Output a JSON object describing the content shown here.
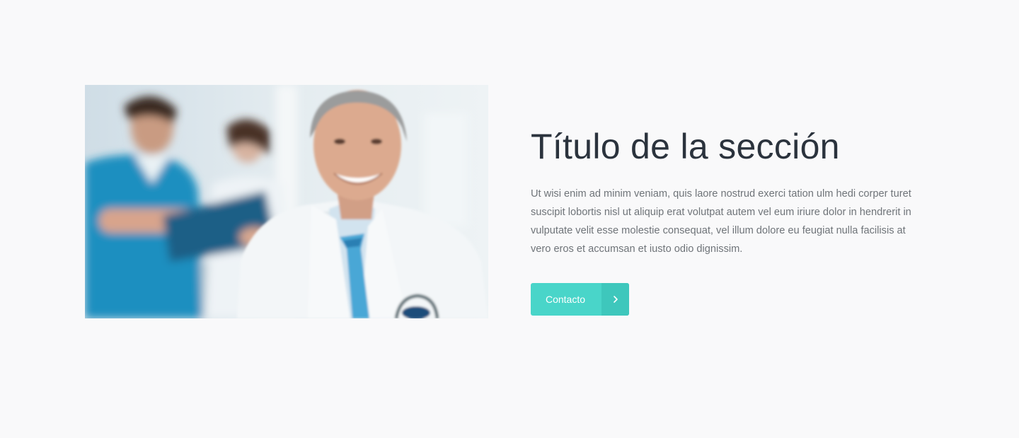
{
  "section": {
    "title": "Título de la sección",
    "body": "Ut wisi enim ad minim veniam, quis laore nostrud exerci tation ulm hedi corper turet suscipit lobortis nisl ut aliquip erat volutpat autem vel eum iriure dolor in hendrerit in vulputate velit esse molestie consequat, vel illum dolore eu feugiat nulla facilisis at vero eros et accumsan et iusto odio dignissim.",
    "button": {
      "label": "Contacto",
      "icon": "chevron-right-icon"
    },
    "image": {
      "subject": "doctor-photo"
    }
  },
  "colors": {
    "background": "#f9f9fa",
    "title": "#2b333d",
    "body": "#6f7479",
    "accent": "#49d5c9",
    "accent_dark": "#3ec7bc"
  }
}
